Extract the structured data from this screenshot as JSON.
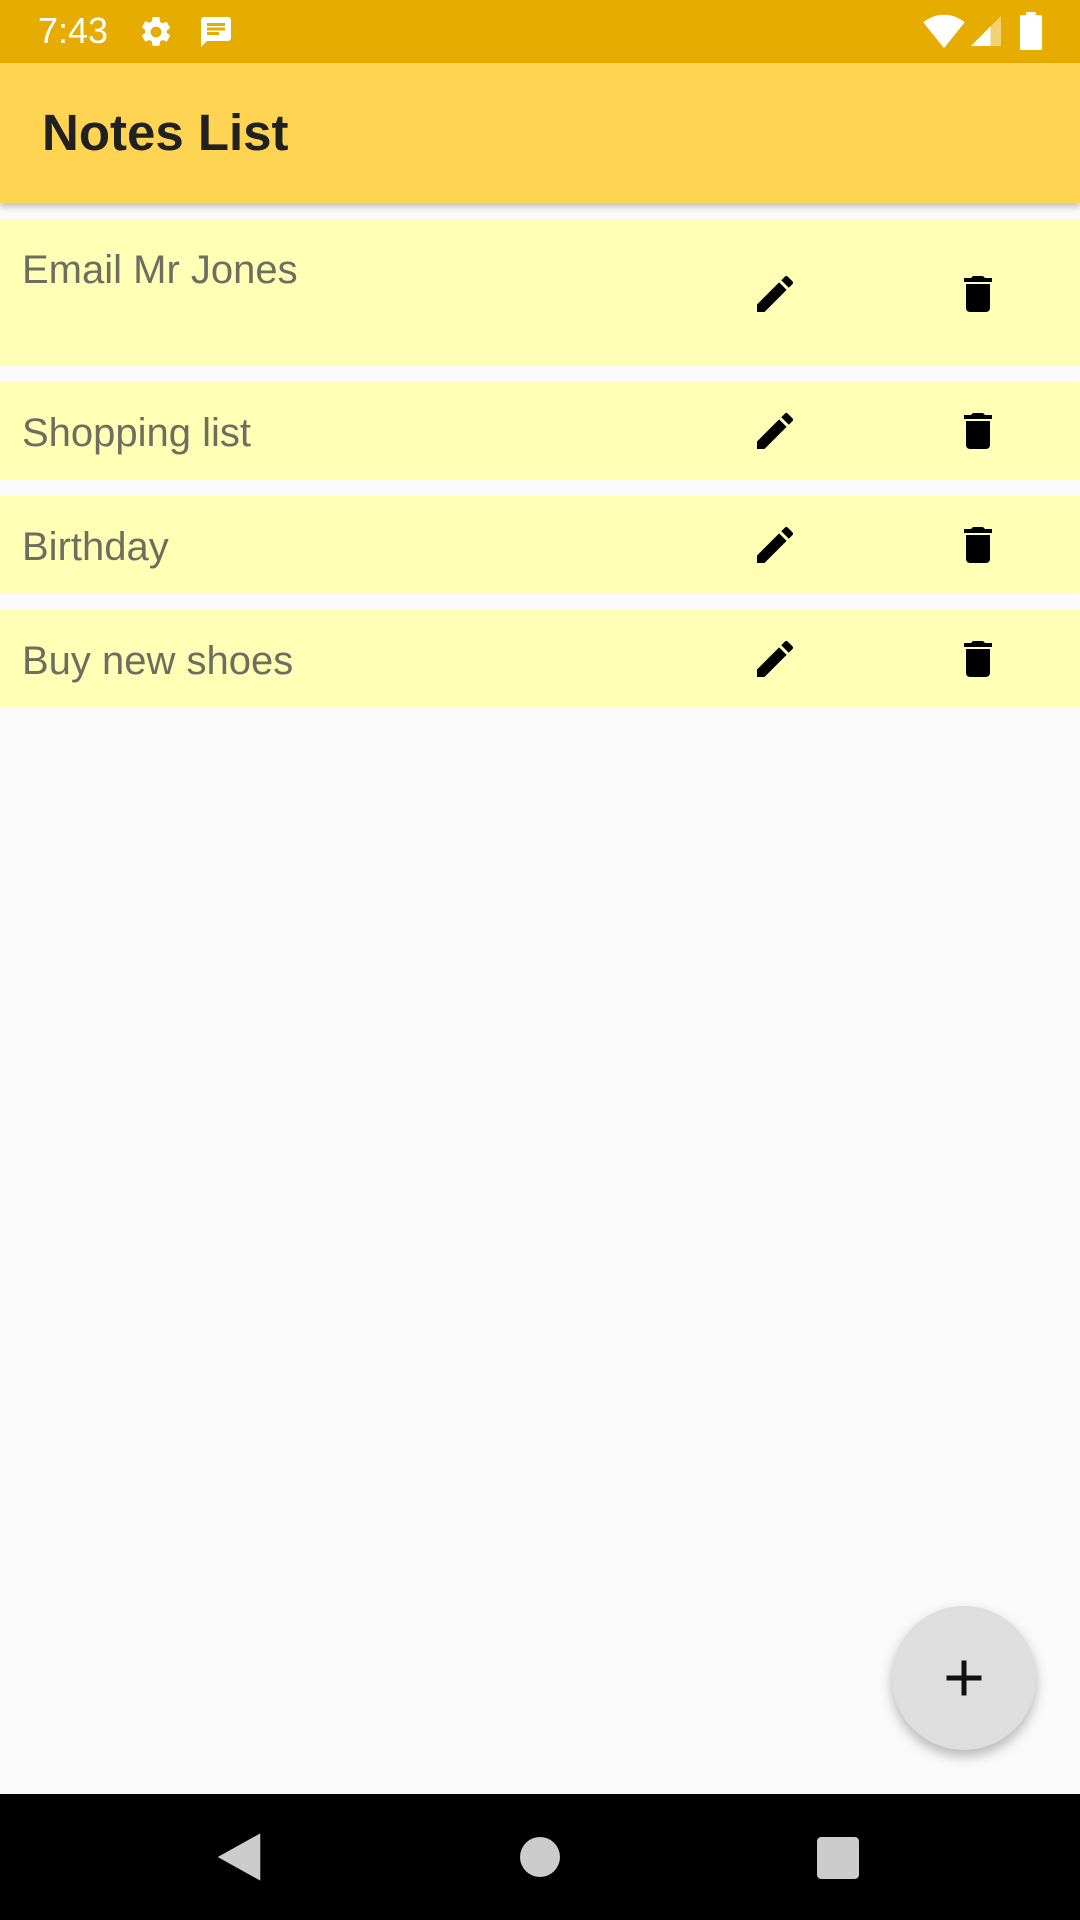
{
  "status_bar": {
    "time": "7:43",
    "icons": [
      "settings-icon",
      "notification-icon",
      "wifi-icon",
      "signal-icon",
      "battery-icon"
    ],
    "background": "#e6ac00"
  },
  "app_bar": {
    "title": "Notes List",
    "background": "#ffd452"
  },
  "notes": [
    {
      "title": "Email Mr Jones",
      "actions": [
        "edit-icon",
        "delete-icon"
      ]
    },
    {
      "title": "Shopping list",
      "actions": [
        "edit-icon",
        "delete-icon"
      ]
    },
    {
      "title": "Birthday",
      "actions": [
        "edit-icon",
        "delete-icon"
      ]
    },
    {
      "title": "Buy new shoes",
      "actions": [
        "edit-icon",
        "delete-icon"
      ]
    }
  ],
  "note_background": "#ffffb5",
  "fab": {
    "icon": "plus-icon"
  },
  "nav_bar": {
    "icons": [
      "back-icon",
      "home-icon",
      "recents-icon"
    ]
  }
}
